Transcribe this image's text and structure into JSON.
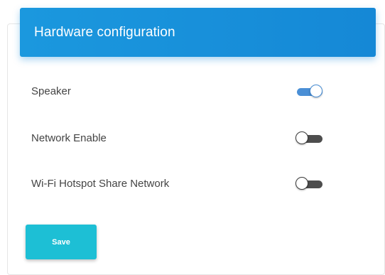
{
  "header": {
    "title": "Hardware configuration"
  },
  "settings": [
    {
      "label": "Speaker",
      "enabled": true
    },
    {
      "label": "Network Enable",
      "enabled": false
    },
    {
      "label": "Wi-Fi Hotspot Share Network",
      "enabled": false
    }
  ],
  "actions": {
    "save_label": "Save"
  },
  "colors": {
    "header_bg": "#1b98de",
    "toggle_on": "#4a8fd6",
    "toggle_off": "#4d4d4d",
    "save_button_bg": "#1dbfd5"
  }
}
